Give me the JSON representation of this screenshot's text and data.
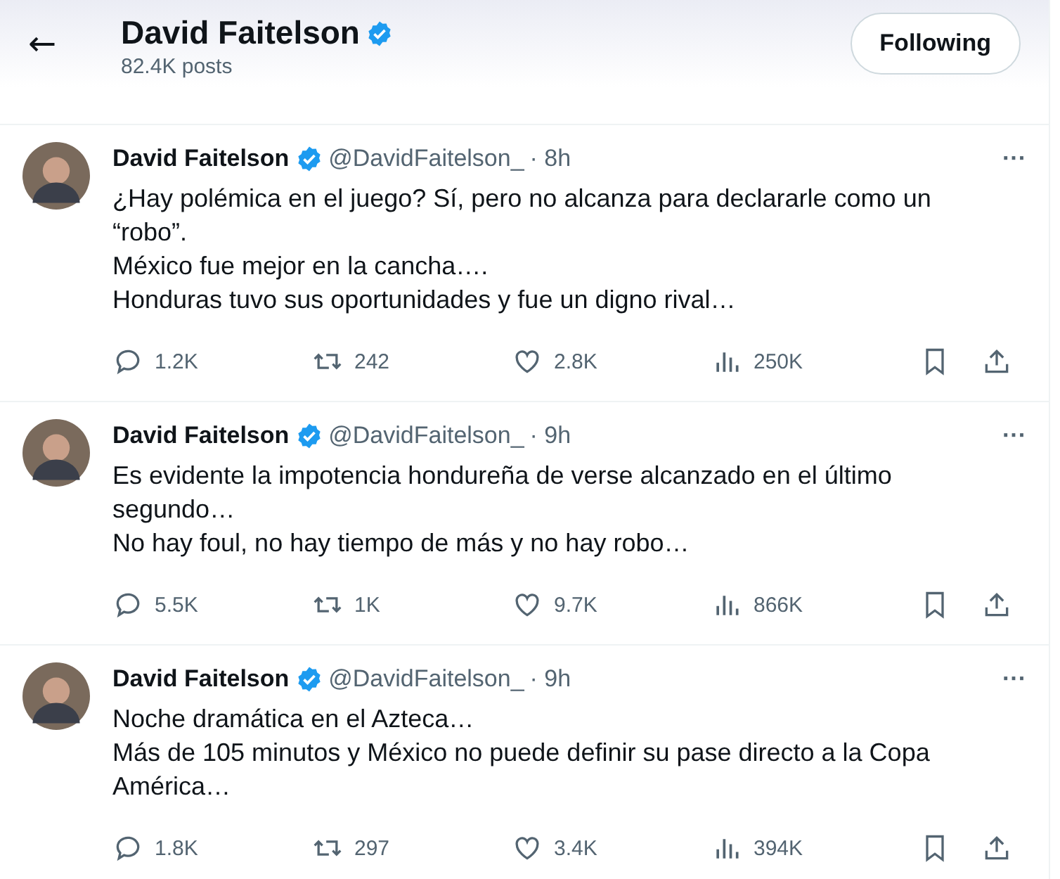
{
  "header": {
    "back": "←",
    "name": "David Faitelson",
    "verified": true,
    "posts": "82.4K posts",
    "follow_button": "Following"
  },
  "tweets": [
    {
      "name": "David Faitelson",
      "verified": true,
      "handle": "@DavidFaitelson_",
      "time": "· 8h",
      "more": "···",
      "lines": [
        "¿Hay polémica en el juego? Sí, pero no alcanza para declararle como un “robo”.",
        "México fue mejor en la cancha….",
        "Honduras tuvo sus oportunidades y fue un digno rival…"
      ],
      "replies": "1.2K",
      "retweets": "242",
      "likes": "2.8K",
      "views": "250K"
    },
    {
      "name": "David Faitelson",
      "verified": true,
      "handle": "@DavidFaitelson_",
      "time": "· 9h",
      "more": "···",
      "lines": [
        "Es evidente la impotencia hondureña de verse alcanzado en el último segundo…",
        "No hay foul, no hay tiempo de más y no hay robo…"
      ],
      "replies": "5.5K",
      "retweets": "1K",
      "likes": "9.7K",
      "views": "866K"
    },
    {
      "name": "David Faitelson",
      "verified": true,
      "handle": "@DavidFaitelson_",
      "time": "· 9h",
      "more": "···",
      "lines": [
        "Noche dramática en el Azteca…",
        "Más de 105 minutos y México no puede definir su pase directo a la Copa América…"
      ],
      "replies": "1.8K",
      "retweets": "297",
      "likes": "3.4K",
      "views": "394K"
    }
  ]
}
